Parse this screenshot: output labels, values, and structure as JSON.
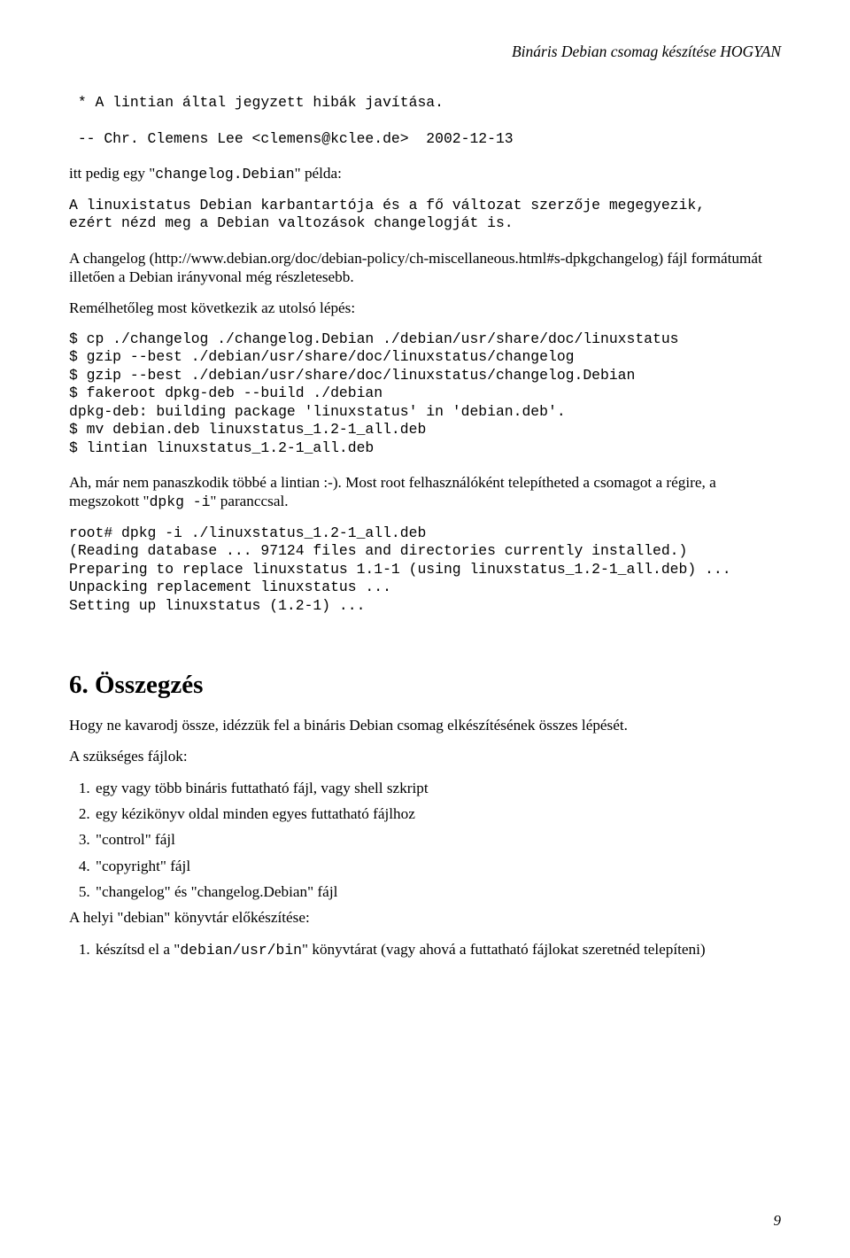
{
  "header": {
    "running_title": "Bináris Debian csomag készítése HOGYAN"
  },
  "code_block_1": " * A lintian által jegyzett hibák javítása.\n\n -- Chr. Clemens Lee <clemens@kclee.de>  2002-12-13",
  "para_1_prefix": "itt pedig egy \"",
  "para_1_code": "changelog.Debian",
  "para_1_suffix": "\" példa:",
  "code_block_2": "A linuxistatus Debian karbantartója és a fő változat szerzője megegyezik,\nezért nézd meg a Debian valtozások changelogját is.",
  "para_2": "A changelog (http://www.debian.org/doc/debian-policy/ch-miscellaneous.html#s-dpkgchangelog) fájl formátumát illetően a Debian irányvonal még részletesebb.",
  "para_3": "Remélhetőleg most következik az utolsó lépés:",
  "code_block_3": "$ cp ./changelog ./changelog.Debian ./debian/usr/share/doc/linuxstatus\n$ gzip --best ./debian/usr/share/doc/linuxstatus/changelog\n$ gzip --best ./debian/usr/share/doc/linuxstatus/changelog.Debian\n$ fakeroot dpkg-deb --build ./debian\ndpkg-deb: building package 'linuxstatus' in 'debian.deb'.\n$ mv debian.deb linuxstatus_1.2-1_all.deb\n$ lintian linuxstatus_1.2-1_all.deb",
  "para_4_prefix": "Ah, már nem panaszkodik többé a lintian :-). Most root felhasználóként telepítheted a csomagot a régire, a megszokott \"",
  "para_4_code": "dpkg -i",
  "para_4_suffix": "\" paranccsal.",
  "code_block_4": "root# dpkg -i ./linuxstatus_1.2-1_all.deb\n(Reading database ... 97124 files and directories currently installed.)\nPreparing to replace linuxstatus 1.1-1 (using linuxstatus_1.2-1_all.deb) ...\nUnpacking replacement linuxstatus ...\nSetting up linuxstatus (1.2-1) ...",
  "section6": {
    "title": "6. Összegzés",
    "intro": "Hogy ne kavarodj össze, idézzük fel a bináris Debian csomag elkészítésének összes lépését.",
    "files_label": "A szükséges fájlok:",
    "steps": [
      "egy vagy több bináris futtatható fájl, vagy shell szkript",
      "egy kézikönyv oldal minden egyes futtatható fájlhoz",
      "\"control\" fájl",
      "\"copyright\" fájl",
      "\"changelog\" és \"changelog.Debian\" fájl"
    ],
    "prep_label": "A helyi \"debian\" könyvtár előkészítése:",
    "step_b1_prefix": "készítsd el a \"",
    "step_b1_code": "debian/usr/bin",
    "step_b1_suffix": "\" könyvtárat (vagy ahová a futtatható fájlokat szeretnéd telepíteni)"
  },
  "page_number": "9"
}
